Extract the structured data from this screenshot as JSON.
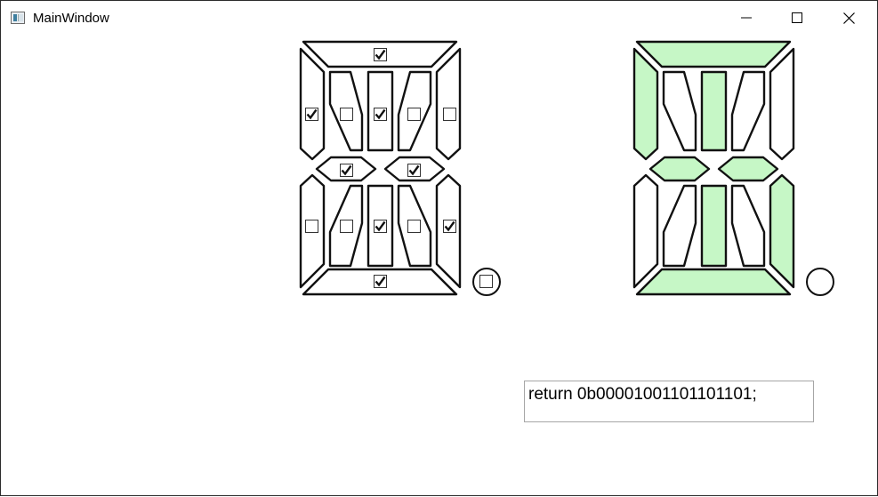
{
  "window": {
    "title": "MainWindow",
    "icon": "app-window-icon",
    "controls": [
      "minimize-icon",
      "maximize-icon",
      "close-icon"
    ]
  },
  "editor": {
    "segments": [
      {
        "id": "top",
        "checked": true
      },
      {
        "id": "upper-left",
        "checked": true
      },
      {
        "id": "upper-left-diagonal",
        "checked": false
      },
      {
        "id": "upper-center",
        "checked": true
      },
      {
        "id": "upper-right-diagonal",
        "checked": false
      },
      {
        "id": "upper-right",
        "checked": false
      },
      {
        "id": "middle-left",
        "checked": true
      },
      {
        "id": "middle-right",
        "checked": true
      },
      {
        "id": "lower-left",
        "checked": false
      },
      {
        "id": "lower-left-diagonal",
        "checked": false
      },
      {
        "id": "lower-center",
        "checked": true
      },
      {
        "id": "lower-right-diagonal",
        "checked": false
      },
      {
        "id": "lower-right",
        "checked": true
      },
      {
        "id": "bottom",
        "checked": true
      }
    ],
    "decimal_point_checked": false
  },
  "preview": {
    "lit_color": "#c6f7c6",
    "off_color": "#ffffff",
    "lit_segments": [
      "top",
      "upper-left",
      "upper-center",
      "middle-left",
      "middle-right",
      "lower-center",
      "lower-right",
      "bottom"
    ],
    "decimal_point_lit": false
  },
  "output": {
    "code": "return 0b00001001101101101;"
  }
}
